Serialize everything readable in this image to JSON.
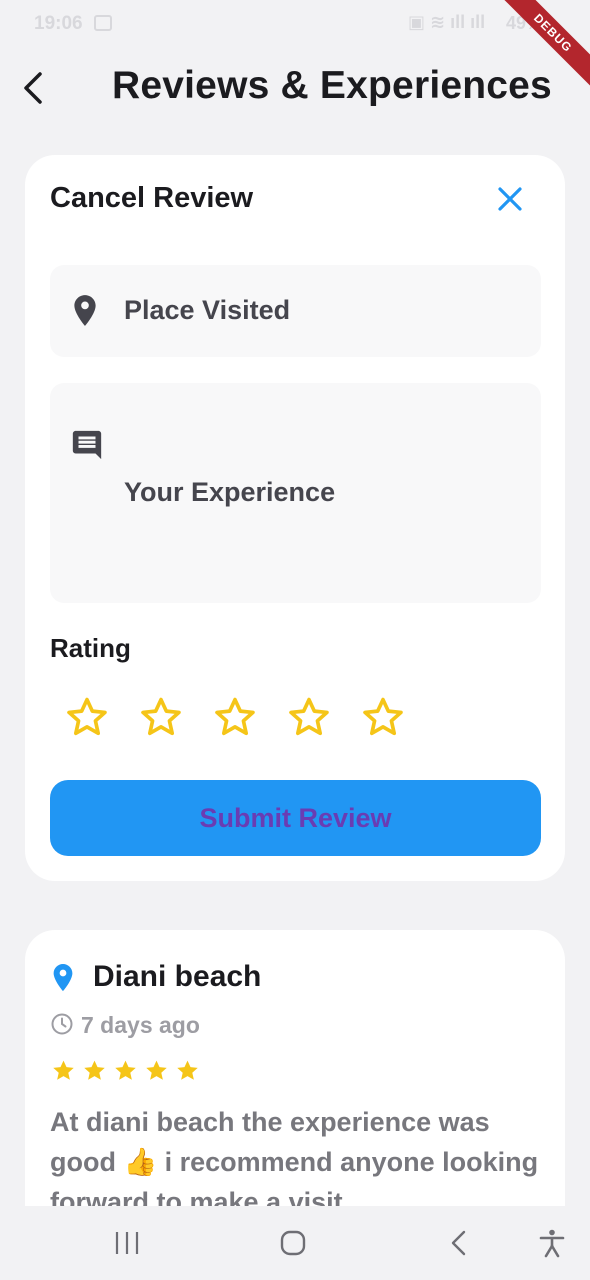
{
  "status_bar": {
    "time": "19:06",
    "battery": "49%",
    "debug_banner": "DEBUG"
  },
  "header": {
    "title": "Reviews & Experiences"
  },
  "review_form": {
    "title": "Cancel Review",
    "place_placeholder": "Place Visited",
    "experience_placeholder": "Your Experience",
    "rating_label": "Rating",
    "rating_value": 0,
    "rating_max": 5,
    "submit_label": "Submit Review"
  },
  "reviews": [
    {
      "place": "Diani beach",
      "time_ago": "7 days ago",
      "rating": 5,
      "text": "At diani beach the experience was good 👍 i recommend anyone looking forward to make a visit"
    }
  ],
  "colors": {
    "accent_blue": "#2196f3",
    "star_gold": "#f5c518",
    "submit_text": "#6a3cb3",
    "background": "#f2f2f4"
  },
  "icons": {
    "back": "chevron-left-icon",
    "close": "close-icon",
    "place": "location-pin-icon",
    "experience": "comment-icon",
    "star": "star-icon",
    "clock": "clock-icon"
  }
}
